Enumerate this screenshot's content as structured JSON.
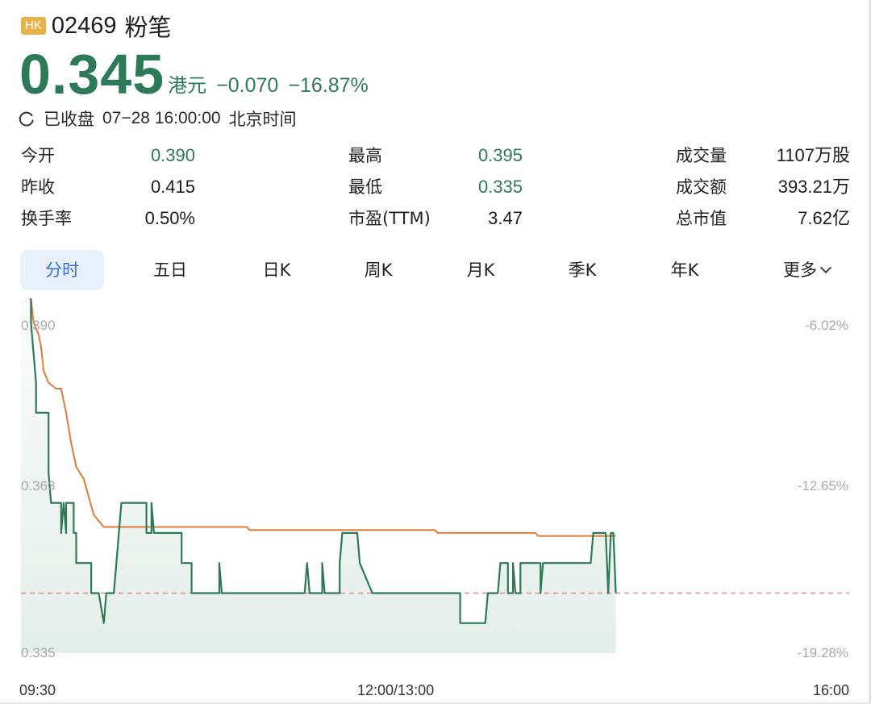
{
  "header": {
    "market_badge": "HK",
    "code": "02469",
    "name": "粉笔"
  },
  "quote": {
    "price": "0.345",
    "currency": "港元",
    "change": "−0.070",
    "change_pct": "−16.87%"
  },
  "status": {
    "icon": "clock-icon",
    "state": "已收盘",
    "datetime": "07−28 16:00:00",
    "timezone": "北京时间"
  },
  "stats": [
    {
      "label": "今开",
      "value": "0.390",
      "color": "#2d7a59"
    },
    {
      "label": "最高",
      "value": "0.395",
      "color": "#2d7a59"
    },
    {
      "label": "成交量",
      "value": "1107万股",
      "color": "#1d1d1d"
    },
    {
      "label": "昨收",
      "value": "0.415",
      "color": "#1d1d1d"
    },
    {
      "label": "最低",
      "value": "0.335",
      "color": "#2d7a59"
    },
    {
      "label": "成交额",
      "value": "393.21万",
      "color": "#1d1d1d"
    },
    {
      "label": "换手率",
      "value": "0.50%",
      "color": "#1d1d1d"
    },
    {
      "label": "市盈(TTM)",
      "value": "3.47",
      "color": "#1d1d1d"
    },
    {
      "label": "总市值",
      "value": "7.62亿",
      "color": "#1d1d1d"
    }
  ],
  "tabs": [
    {
      "label": "分时",
      "active": true
    },
    {
      "label": "五日",
      "active": false
    },
    {
      "label": "日K",
      "active": false
    },
    {
      "label": "周K",
      "active": false
    },
    {
      "label": "月K",
      "active": false
    },
    {
      "label": "季K",
      "active": false
    },
    {
      "label": "年K",
      "active": false
    },
    {
      "label": "更多",
      "active": false
    }
  ],
  "colors": {
    "price_line": "#2d7a59",
    "avg_line": "#e07b39",
    "prev_close_line": "#e88a8a",
    "badge": "#e8b24a",
    "tab_active_bg": "#e8f0fc",
    "tab_active_text": "#3b6ed3"
  },
  "chart_data": {
    "type": "line",
    "y_left_labels": [
      "0.390",
      "0.363",
      "0.335"
    ],
    "y_right_labels": [
      "-6.02%",
      "-12.65%",
      "-19.28%"
    ],
    "x_labels": [
      "09:30",
      "12:00/13:00",
      "16:00"
    ],
    "ylim": [
      0.335,
      0.39
    ],
    "prev_close_ref": 0.345,
    "x_range": [
      0,
      330
    ],
    "series": [
      {
        "key": "price",
        "points": [
          [
            0,
            0.395
          ],
          [
            4,
            0.395
          ],
          [
            4,
            0.39
          ],
          [
            6,
            0.38
          ],
          [
            6,
            0.375
          ],
          [
            11,
            0.375
          ],
          [
            11,
            0.365
          ],
          [
            12,
            0.36
          ],
          [
            16,
            0.36
          ],
          [
            16,
            0.355
          ],
          [
            17,
            0.36
          ],
          [
            18,
            0.355
          ],
          [
            18,
            0.36
          ],
          [
            21,
            0.36
          ],
          [
            21,
            0.355
          ],
          [
            22,
            0.355
          ],
          [
            22,
            0.35
          ],
          [
            28,
            0.35
          ],
          [
            28,
            0.345
          ],
          [
            31,
            0.345
          ],
          [
            33,
            0.34
          ],
          [
            34,
            0.345
          ],
          [
            37,
            0.345
          ],
          [
            38,
            0.35
          ],
          [
            39,
            0.355
          ],
          [
            40,
            0.36
          ],
          [
            50,
            0.36
          ],
          [
            50,
            0.355
          ],
          [
            52,
            0.355
          ],
          [
            52,
            0.36
          ],
          [
            53,
            0.355
          ],
          [
            64,
            0.355
          ],
          [
            64,
            0.35
          ],
          [
            68,
            0.35
          ],
          [
            68,
            0.345
          ],
          [
            79,
            0.345
          ],
          [
            79,
            0.35
          ],
          [
            80,
            0.345
          ],
          [
            113,
            0.345
          ],
          [
            114,
            0.35
          ],
          [
            115,
            0.345
          ],
          [
            120,
            0.345
          ],
          [
            120,
            0.35
          ],
          [
            121,
            0.345
          ],
          [
            127,
            0.345
          ],
          [
            127,
            0.35
          ],
          [
            128,
            0.355
          ],
          [
            134,
            0.355
          ],
          [
            135,
            0.35
          ],
          [
            140,
            0.345
          ],
          [
            175,
            0.345
          ],
          [
            175,
            0.34
          ],
          [
            185,
            0.34
          ],
          [
            186,
            0.345
          ],
          [
            190,
            0.345
          ],
          [
            191,
            0.35
          ],
          [
            194,
            0.35
          ],
          [
            194,
            0.345
          ],
          [
            196,
            0.345
          ],
          [
            196,
            0.35
          ],
          [
            197,
            0.345
          ],
          [
            199,
            0.345
          ],
          [
            199,
            0.35
          ],
          [
            207,
            0.35
          ],
          [
            207,
            0.345
          ],
          [
            208,
            0.35
          ],
          [
            227,
            0.35
          ],
          [
            228,
            0.355
          ],
          [
            233,
            0.355
          ],
          [
            234,
            0.345
          ],
          [
            235,
            0.355
          ],
          [
            236,
            0.355
          ],
          [
            237,
            0.345
          ]
        ]
      },
      {
        "key": "average",
        "points": [
          [
            0,
            0.3945
          ],
          [
            4,
            0.394
          ],
          [
            5,
            0.39
          ],
          [
            7,
            0.388
          ],
          [
            8,
            0.386
          ],
          [
            9,
            0.382
          ],
          [
            11,
            0.38
          ],
          [
            14,
            0.379
          ],
          [
            16,
            0.379
          ],
          [
            18,
            0.375
          ],
          [
            20,
            0.37
          ],
          [
            22,
            0.366
          ],
          [
            25,
            0.364
          ],
          [
            27,
            0.361
          ],
          [
            29,
            0.358
          ],
          [
            31,
            0.357
          ],
          [
            33,
            0.356
          ],
          [
            36,
            0.356
          ],
          [
            90,
            0.356
          ],
          [
            91,
            0.3555
          ],
          [
            165,
            0.3555
          ],
          [
            166,
            0.355
          ],
          [
            205,
            0.355
          ],
          [
            206,
            0.3545
          ],
          [
            237,
            0.3545
          ]
        ]
      }
    ]
  }
}
